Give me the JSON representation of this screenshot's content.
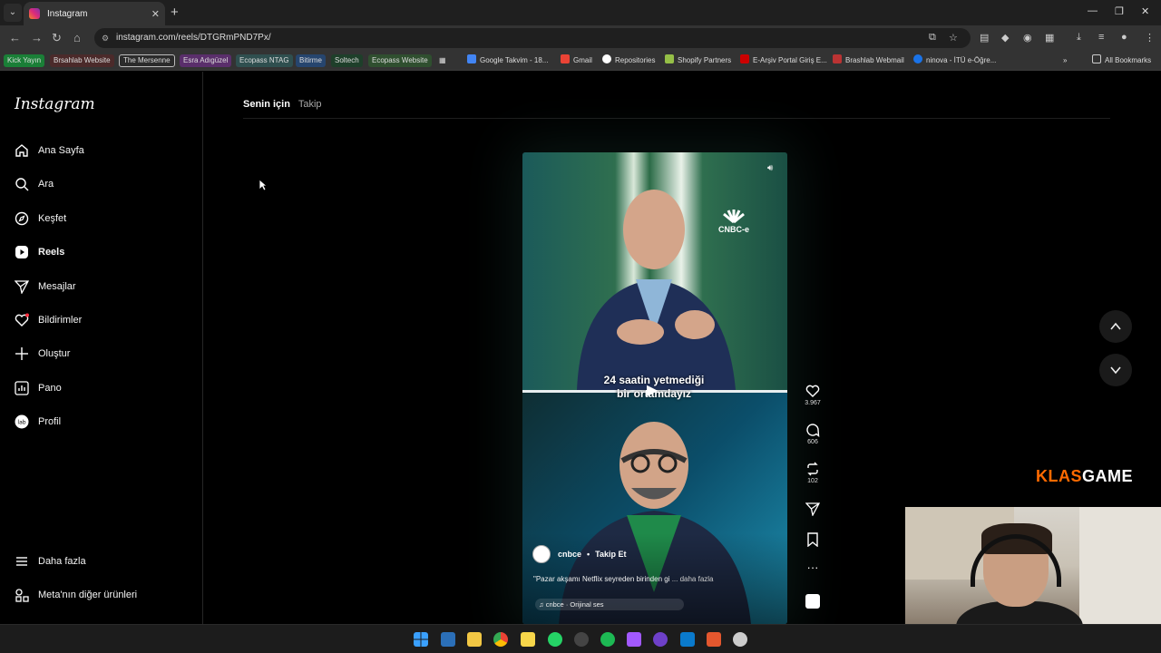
{
  "browser": {
    "tab_title": "Instagram",
    "url": "instagram.com/reels/DTGRmPND7Px/",
    "bookmarks": [
      {
        "label": "Kick Yayın",
        "color": "#1a7f37"
      },
      {
        "label": "Brsahlab Website",
        "color": "#4b2a2a"
      },
      {
        "label": "The Mersenne",
        "color": "#2b2b2b"
      },
      {
        "label": "Esra Adıgüzel",
        "color": "#5a2e6b"
      },
      {
        "label": "Ecopass NTAG",
        "color": "#2f4f4f"
      },
      {
        "label": "Bitirme",
        "color": "#26456e"
      },
      {
        "label": "Soltech",
        "color": "#1e3f2a"
      },
      {
        "label": "Ecopass Website",
        "color": "#2f4f2f"
      }
    ],
    "bookmarks_links": [
      "Google Takvim - 18...",
      "Gmail",
      "Repositories",
      "Shopify Partners",
      "E-Arşiv Portal Giriş E...",
      "Brashlab Webmail",
      "ninova - İTÜ e-Öğre..."
    ],
    "all_bookmarks": "All Bookmarks"
  },
  "sidebar": {
    "logo": "Instagram",
    "items": [
      {
        "label": "Ana Sayfa",
        "icon": "home-icon"
      },
      {
        "label": "Ara",
        "icon": "search-icon"
      },
      {
        "label": "Keşfet",
        "icon": "compass-icon"
      },
      {
        "label": "Reels",
        "icon": "reels-icon"
      },
      {
        "label": "Mesajlar",
        "icon": "send-icon"
      },
      {
        "label": "Bildirimler",
        "icon": "heart-icon"
      },
      {
        "label": "Oluştur",
        "icon": "plus-icon"
      },
      {
        "label": "Pano",
        "icon": "chart-icon"
      },
      {
        "label": "Profil",
        "icon": "profile-icon"
      }
    ],
    "more": "Daha fazla",
    "meta": "Meta'nın diğer ürünleri"
  },
  "feed_tabs": {
    "for_you": "Senin için",
    "following": "Takip"
  },
  "reel": {
    "overlay_line1": "24 saatin yetmediği",
    "overlay_line2": "bir ortamdayız",
    "brand_mark": "CNBC-e",
    "author": "cnbce",
    "follow": "Takip Et",
    "caption": "\"Pazar akşamı Netflix seyreden birinden gi",
    "more": " ... daha fazla",
    "audio": "cnbce · Orijinal ses",
    "likes": "3.967",
    "comments": "606",
    "reposts": "102"
  },
  "watermark": {
    "a": "KLAS",
    "b": "GAME"
  },
  "colors": {
    "accent": "#ff6a00",
    "bg": "#000000"
  }
}
